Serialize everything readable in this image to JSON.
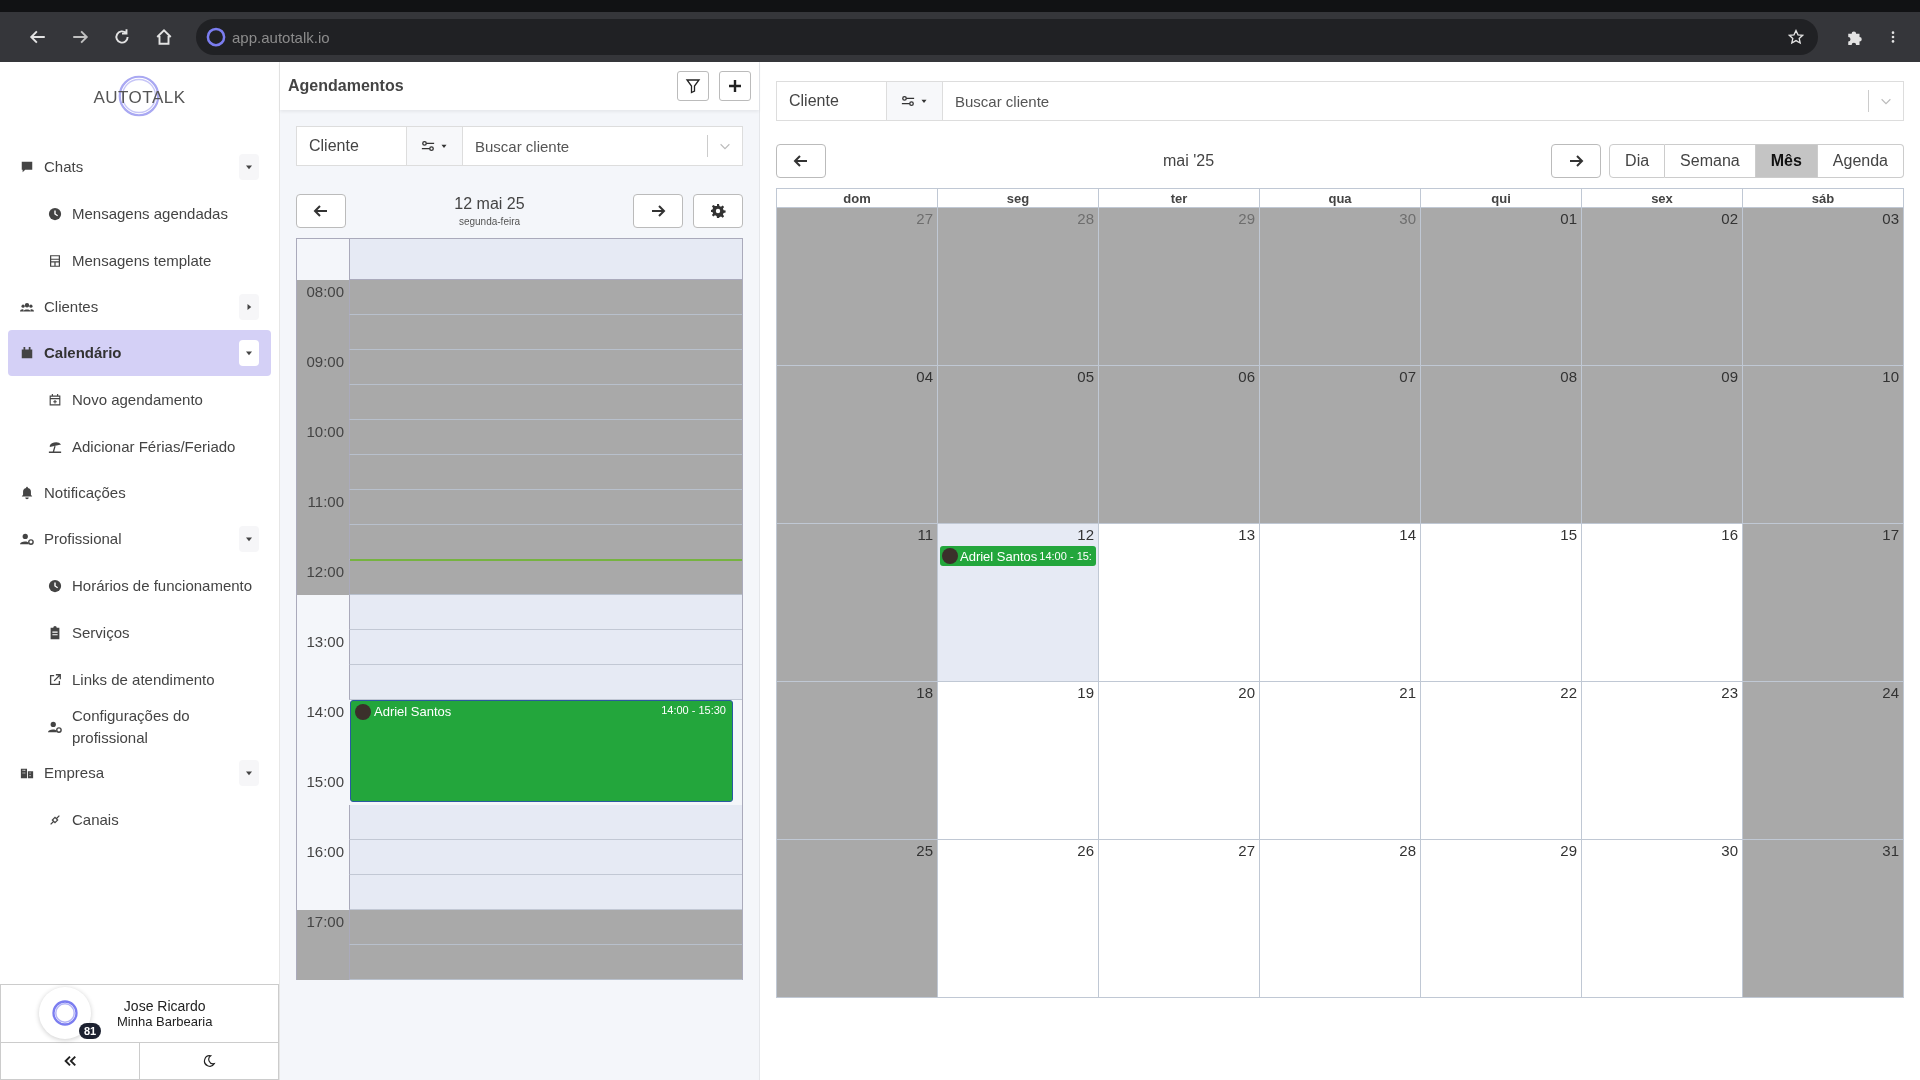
{
  "browser": {
    "url": "app.autotalk.io"
  },
  "sidebar": {
    "logo": "AUTOTALK",
    "items": [
      {
        "label": "Chats",
        "selected": false,
        "expanded": true,
        "children": [
          {
            "label": "Mensagens agendadas",
            "selected": false
          },
          {
            "label": "Mensagens template",
            "selected": false
          }
        ]
      },
      {
        "label": "Clientes",
        "selected": false,
        "expanded": false
      },
      {
        "label": "Calendário",
        "selected": true,
        "expanded": true,
        "children": [
          {
            "label": "Novo agendamento",
            "selected": false
          },
          {
            "label": "Adicionar Férias/Feriado",
            "selected": false
          }
        ]
      },
      {
        "label": "Notificações",
        "selected": false
      },
      {
        "label": "Profissional",
        "selected": false,
        "expanded": true,
        "children": [
          {
            "label": "Horários de funcionamento",
            "selected": false
          },
          {
            "label": "Serviços",
            "selected": false
          },
          {
            "label": "Links de atendimento",
            "selected": false
          },
          {
            "label": "Configurações do profissional",
            "selected": false
          }
        ]
      },
      {
        "label": "Empresa",
        "selected": false,
        "expanded": true,
        "children": [
          {
            "label": "Canais",
            "selected": false
          }
        ]
      }
    ],
    "user": {
      "name": "Jose Ricardo",
      "company": "Minha Barbearia",
      "badge": "81"
    }
  },
  "schedule": {
    "title": "Agendamentos",
    "search": {
      "label": "Cliente",
      "placeholder": "Buscar cliente"
    },
    "date": "12 mai 25",
    "weekday": "segunda-feira",
    "slots": [
      {
        "label": "08:00",
        "closed": true
      },
      {
        "closed": true
      },
      {
        "label": "09:00",
        "closed": true
      },
      {
        "closed": true
      },
      {
        "label": "10:00",
        "closed": true
      },
      {
        "closed": true
      },
      {
        "label": "11:00",
        "closed": true
      },
      {
        "closed": true
      },
      {
        "label": "12:00",
        "closed": true,
        "now": true
      },
      {
        "closed": false
      },
      {
        "label": "13:00",
        "closed": false
      },
      {
        "closed": false
      },
      {
        "label": "14:00",
        "booked": true,
        "event": {
          "name": "Adriel Santos",
          "time": "14:00 - 15:30"
        }
      },
      {
        "booked": true
      },
      {
        "label": "15:00",
        "booked": true
      },
      {
        "closed": false
      },
      {
        "label": "16:00",
        "closed": false
      },
      {
        "closed": false
      },
      {
        "label": "17:00",
        "closed": true
      },
      {
        "closed": true
      }
    ]
  },
  "calendar": {
    "search": {
      "label": "Cliente",
      "placeholder": "Buscar cliente"
    },
    "month": "mai '25",
    "views": [
      {
        "label": "Dia",
        "selected": false
      },
      {
        "label": "Semana",
        "selected": false
      },
      {
        "label": "Mês",
        "selected": true
      },
      {
        "label": "Agenda",
        "selected": false
      }
    ],
    "weekdays": [
      "dom",
      "seg",
      "ter",
      "qua",
      "qui",
      "sex",
      "sáb"
    ],
    "weeks": [
      [
        {
          "number": "27",
          "muted": true,
          "closed": true,
          "today": false
        },
        {
          "number": "28",
          "muted": true,
          "closed": true,
          "today": false
        },
        {
          "number": "29",
          "muted": true,
          "closed": true,
          "today": false
        },
        {
          "number": "30",
          "muted": true,
          "closed": true,
          "today": false
        },
        {
          "number": "01",
          "muted": false,
          "closed": true,
          "today": false
        },
        {
          "number": "02",
          "muted": false,
          "closed": true,
          "today": false
        },
        {
          "number": "03",
          "muted": false,
          "closed": true,
          "today": false
        }
      ],
      [
        {
          "number": "04",
          "muted": false,
          "closed": true,
          "today": false
        },
        {
          "number": "05",
          "muted": false,
          "closed": true,
          "today": false
        },
        {
          "number": "06",
          "muted": false,
          "closed": true,
          "today": false
        },
        {
          "number": "07",
          "muted": false,
          "closed": true,
          "today": false
        },
        {
          "number": "08",
          "muted": false,
          "closed": true,
          "today": false
        },
        {
          "number": "09",
          "muted": false,
          "closed": true,
          "today": false
        },
        {
          "number": "10",
          "muted": false,
          "closed": true,
          "today": false
        }
      ],
      [
        {
          "number": "11",
          "muted": false,
          "closed": true,
          "today": false
        },
        {
          "number": "12",
          "muted": false,
          "closed": false,
          "today": true,
          "events": [
            {
              "name": "Adriel Santos",
              "time": "14:00 - 15:"
            }
          ]
        },
        {
          "number": "13",
          "muted": false,
          "closed": false,
          "today": false
        },
        {
          "number": "14",
          "muted": false,
          "closed": false,
          "today": false
        },
        {
          "number": "15",
          "muted": false,
          "closed": false,
          "today": false
        },
        {
          "number": "16",
          "muted": false,
          "closed": false,
          "today": false
        },
        {
          "number": "17",
          "muted": false,
          "closed": true,
          "today": false
        }
      ],
      [
        {
          "number": "18",
          "muted": false,
          "closed": true,
          "today": false
        },
        {
          "number": "19",
          "muted": false,
          "closed": false,
          "today": false
        },
        {
          "number": "20",
          "muted": false,
          "closed": false,
          "today": false
        },
        {
          "number": "21",
          "muted": false,
          "closed": false,
          "today": false
        },
        {
          "number": "22",
          "muted": false,
          "closed": false,
          "today": false
        },
        {
          "number": "23",
          "muted": false,
          "closed": false,
          "today": false
        },
        {
          "number": "24",
          "muted": false,
          "closed": true,
          "today": false
        }
      ],
      [
        {
          "number": "25",
          "muted": false,
          "closed": true,
          "today": false
        },
        {
          "number": "26",
          "muted": false,
          "closed": false,
          "today": false
        },
        {
          "number": "27",
          "muted": false,
          "closed": false,
          "today": false
        },
        {
          "number": "28",
          "muted": false,
          "closed": false,
          "today": false
        },
        {
          "number": "29",
          "muted": false,
          "closed": false,
          "today": false
        },
        {
          "number": "30",
          "muted": false,
          "closed": false,
          "today": false
        },
        {
          "number": "31",
          "muted": false,
          "closed": true,
          "today": false
        }
      ]
    ]
  }
}
